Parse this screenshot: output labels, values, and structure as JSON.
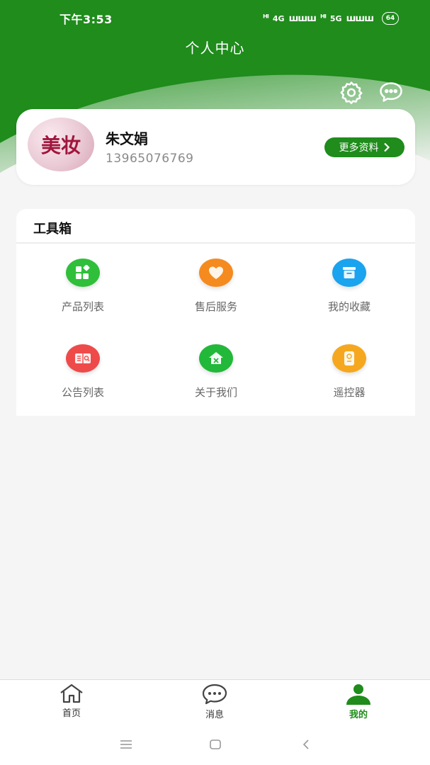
{
  "status_bar": {
    "time": "下午3:53",
    "network1": "4G",
    "network2": "5G",
    "battery": "64"
  },
  "header": {
    "title": "个人中心"
  },
  "profile": {
    "avatar_text": "美妆",
    "name": "朱文娟",
    "phone": "13965076769",
    "more_button": "更多资料"
  },
  "toolbox": {
    "title": "工具箱",
    "items": [
      {
        "label": "产品列表",
        "icon": "grid-icon",
        "color": "#2fbf3a"
      },
      {
        "label": "售后服务",
        "icon": "heart-icon",
        "color": "#f58a1f"
      },
      {
        "label": "我的收藏",
        "icon": "archive-icon",
        "color": "#1aa3ee"
      },
      {
        "label": "公告列表",
        "icon": "book-search-icon",
        "color": "#ef4a4a"
      },
      {
        "label": "关于我们",
        "icon": "home-icon",
        "color": "#22b83a"
      },
      {
        "label": "遥控器",
        "icon": "remote-icon",
        "color": "#f5a81f"
      }
    ]
  },
  "tabbar": {
    "items": [
      {
        "label": "首页",
        "icon": "home-outline-icon"
      },
      {
        "label": "消息",
        "icon": "chat-bubble-icon"
      },
      {
        "label": "我的",
        "icon": "person-icon",
        "active": true
      }
    ]
  },
  "colors": {
    "accent": "#1f8c1c",
    "background": "#f5f5f5"
  }
}
